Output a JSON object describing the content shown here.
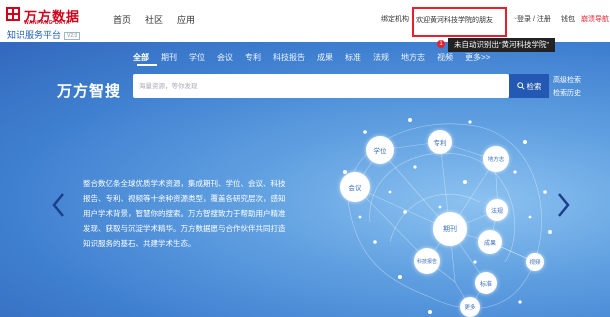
{
  "logo": {
    "name": "万方数据",
    "english": "WANFANG DATA",
    "subtitle": "知识服务平台",
    "version": "V2.0"
  },
  "main_nav": [
    "首页",
    "社区",
    "应用"
  ],
  "right_nav": {
    "bind_org": "绑定机构",
    "welcome": "欢迎黄河科技学院的朋友",
    "login": "登录 / 注册",
    "wallet": "钱包",
    "feedback": "崩溃导航"
  },
  "notification": {
    "count": "1",
    "message": "未自动识别出“黄河科技学院”"
  },
  "hero": {
    "tabs": [
      "全部",
      "期刊",
      "学位",
      "会议",
      "专利",
      "科技报告",
      "成果",
      "标准",
      "法规",
      "地方志",
      "视频",
      "更多>>"
    ],
    "active_tab": "全部",
    "brand": "万方智搜",
    "search_placeholder": "海量资源，等你发现",
    "search_button": "检索",
    "advanced_search": "高级检索",
    "search_history": "检索历史",
    "description": "整合数亿条全球优质学术资源，集成期刊、学位、会议、科技报告、专利、视频等十余种资源类型，覆盖各研究层次，感知用户学术背景，智慧你的搜索。万方智搜致力于帮助用户精准发现、获取与沉淀学术精华。万方数据愿与合作伙伴共同打造知识服务的基石、共建学术生态。"
  },
  "brain_nodes": [
    "学位",
    "专利",
    "会议",
    "期刊",
    "地方志",
    "法规",
    "成果",
    "科技报告",
    "标准",
    "视频",
    "更多"
  ],
  "colors": {
    "brand_red": "#d0021b",
    "highlight_red": "#e8202e",
    "hero_blue": "#3f7fd0",
    "button_blue": "#2459b3"
  }
}
